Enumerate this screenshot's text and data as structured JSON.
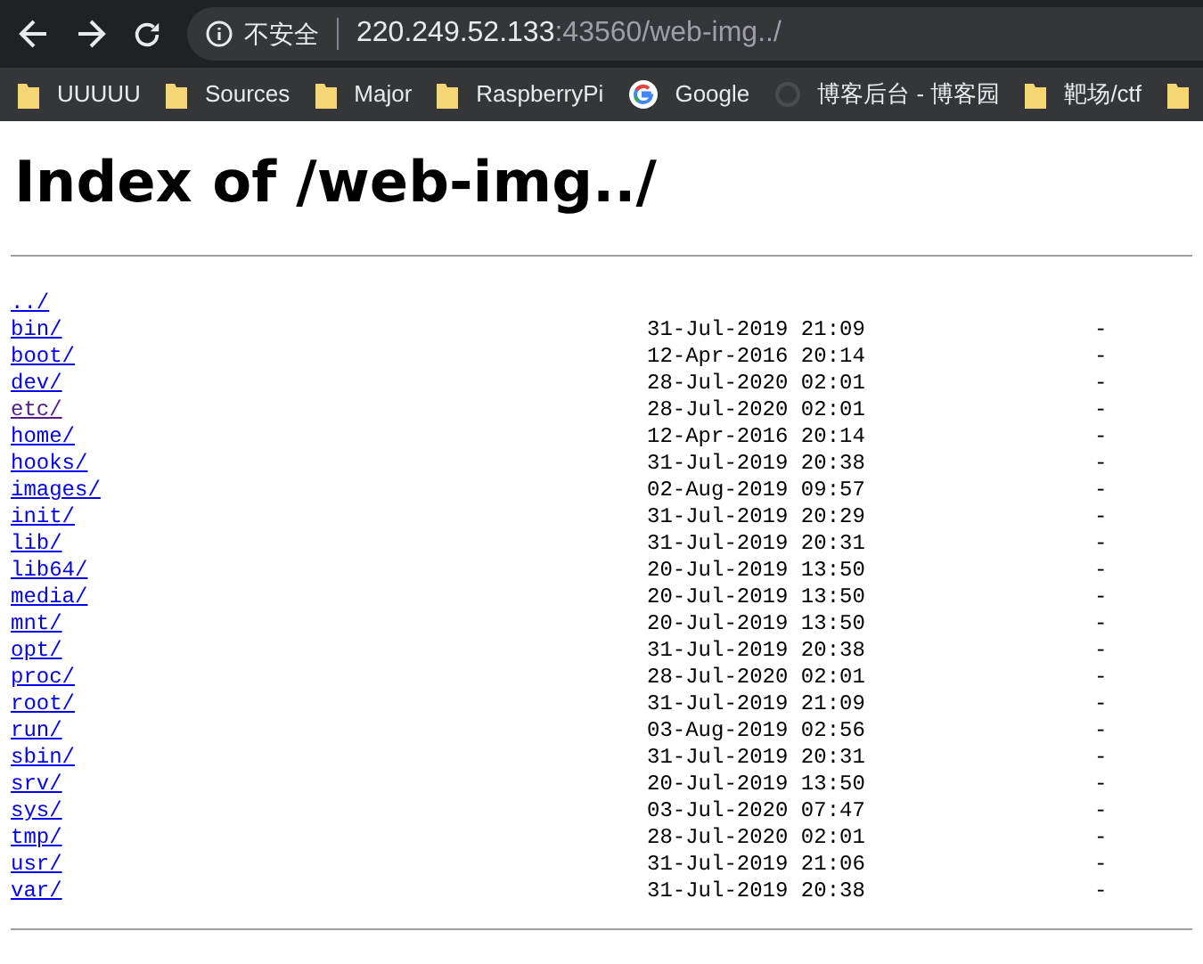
{
  "toolbar": {
    "security_label": "不安全",
    "url_host": "220.249.52.133",
    "url_rest": ":43560/web-img../"
  },
  "bookmarks": [
    {
      "kind": "folder",
      "label": "UUUUU"
    },
    {
      "kind": "folder",
      "label": "Sources"
    },
    {
      "kind": "folder",
      "label": "Major"
    },
    {
      "kind": "folder",
      "label": "RaspberryPi"
    },
    {
      "kind": "google",
      "label": "Google"
    },
    {
      "kind": "site",
      "label": "博客后台 - 博客园"
    },
    {
      "kind": "folder",
      "label": "靶场/ctf"
    },
    {
      "kind": "folder"
    }
  ],
  "heading": "Index of /web-img../",
  "entries": [
    {
      "name": "../",
      "visited": false
    },
    {
      "name": "bin/",
      "date": "31-Jul-2019 21:09",
      "size": "-",
      "visited": false
    },
    {
      "name": "boot/",
      "date": "12-Apr-2016 20:14",
      "size": "-",
      "visited": false
    },
    {
      "name": "dev/",
      "date": "28-Jul-2020 02:01",
      "size": "-",
      "visited": false
    },
    {
      "name": "etc/",
      "date": "28-Jul-2020 02:01",
      "size": "-",
      "visited": true
    },
    {
      "name": "home/",
      "date": "12-Apr-2016 20:14",
      "size": "-",
      "visited": false
    },
    {
      "name": "hooks/",
      "date": "31-Jul-2019 20:38",
      "size": "-",
      "visited": false
    },
    {
      "name": "images/",
      "date": "02-Aug-2019 09:57",
      "size": "-",
      "visited": false
    },
    {
      "name": "init/",
      "date": "31-Jul-2019 20:29",
      "size": "-",
      "visited": false
    },
    {
      "name": "lib/",
      "date": "31-Jul-2019 20:31",
      "size": "-",
      "visited": false
    },
    {
      "name": "lib64/",
      "date": "20-Jul-2019 13:50",
      "size": "-",
      "visited": false
    },
    {
      "name": "media/",
      "date": "20-Jul-2019 13:50",
      "size": "-",
      "visited": false
    },
    {
      "name": "mnt/",
      "date": "20-Jul-2019 13:50",
      "size": "-",
      "visited": false
    },
    {
      "name": "opt/",
      "date": "31-Jul-2019 20:38",
      "size": "-",
      "visited": false
    },
    {
      "name": "proc/",
      "date": "28-Jul-2020 02:01",
      "size": "-",
      "visited": false
    },
    {
      "name": "root/",
      "date": "31-Jul-2019 21:09",
      "size": "-",
      "visited": false
    },
    {
      "name": "run/",
      "date": "03-Aug-2019 02:56",
      "size": "-",
      "visited": false
    },
    {
      "name": "sbin/",
      "date": "31-Jul-2019 20:31",
      "size": "-",
      "visited": false
    },
    {
      "name": "srv/",
      "date": "20-Jul-2019 13:50",
      "size": "-",
      "visited": false
    },
    {
      "name": "sys/",
      "date": "03-Jul-2020 07:47",
      "size": "-",
      "visited": false
    },
    {
      "name": "tmp/",
      "date": "28-Jul-2020 02:01",
      "size": "-",
      "visited": false
    },
    {
      "name": "usr/",
      "date": "31-Jul-2019 21:06",
      "size": "-",
      "visited": false
    },
    {
      "name": "var/",
      "date": "31-Jul-2019 20:38",
      "size": "-",
      "visited": false
    }
  ]
}
